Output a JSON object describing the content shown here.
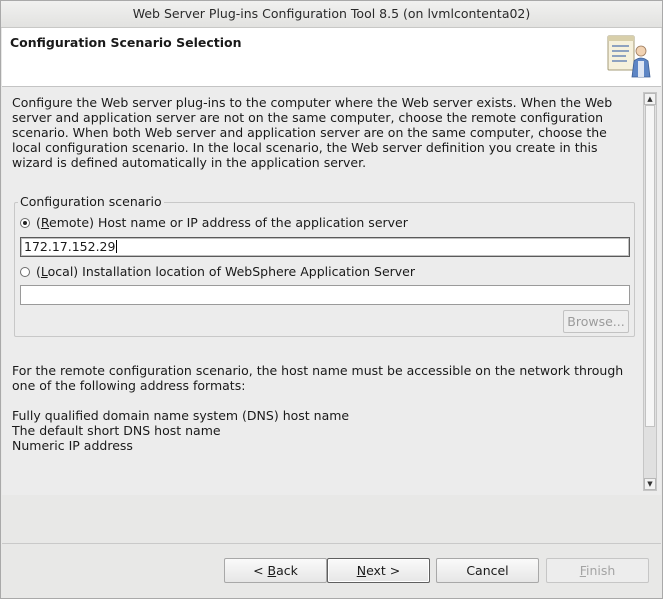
{
  "window": {
    "title": "Web Server Plug-ins Configuration Tool 8.5  (on lvmlcontenta02)"
  },
  "header": {
    "title": "Configuration Scenario Selection",
    "icon": "wizard-document-person-icon"
  },
  "content": {
    "intro": "Configure the Web server plug-ins to the computer where the Web server exists. When the Web server and application server are not on the same computer, choose the remote configuration scenario. When both Web server and application server are on the same computer, choose the local configuration scenario. In the local scenario, the Web server definition you create in this wizard is defined automatically in the application server.",
    "group_label": "Configuration scenario",
    "remote": {
      "prefix": "(",
      "mnemonic": "R",
      "suffix": "emote) Host name or IP address of the application server",
      "selected": true,
      "value": "172.17.152.29"
    },
    "local": {
      "prefix": "(",
      "mnemonic": "L",
      "suffix": "ocal) Installation location of WebSphere Application Server",
      "selected": false,
      "value": ""
    },
    "browse_label": "Browse...",
    "remote_note": "For the remote configuration scenario, the host name must be accessible on the network through one of the following address formats:",
    "formats": [
      "Fully qualified domain name system (DNS) host name",
      "The default short DNS host name",
      "Numeric IP address"
    ]
  },
  "footer": {
    "back": {
      "prefix": "< ",
      "mnemonic": "B",
      "suffix": "ack"
    },
    "next": {
      "mnemonic": "N",
      "suffix": "ext >"
    },
    "cancel": "Cancel",
    "finish": {
      "mnemonic": "F",
      "suffix": "inish"
    }
  }
}
